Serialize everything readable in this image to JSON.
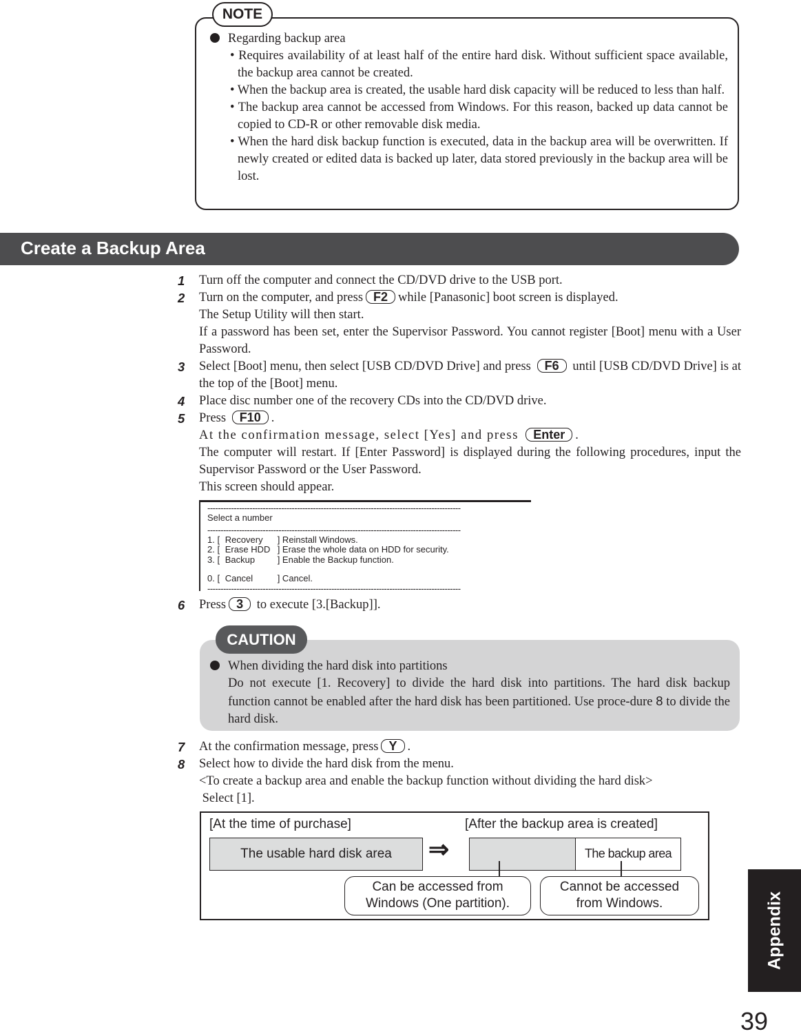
{
  "note": {
    "label": "NOTE",
    "heading": "Regarding backup area",
    "items": [
      "• Requires availability of at least half of the entire hard disk.  Without sufficient space available, the backup area cannot be created.",
      "• When the backup area is created, the usable hard disk capacity will be reduced to less than half.",
      "• The backup area cannot be accessed from Windows.  For this reason, backed up data cannot be copied to CD-R or other removable disk media.",
      "• When the hard disk backup function is executed, data in the backup area will be overwritten.  If newly created or edited data is backed up later, data stored previously in the backup area will be lost."
    ]
  },
  "section_title": "Create a Backup Area",
  "steps": {
    "s1": {
      "num": "1",
      "text": "Turn off the computer and connect the CD/DVD drive to the USB port."
    },
    "s2": {
      "num": "2",
      "a": "Turn on the computer, and press",
      "key": "F2",
      "b": "while [Panasonic] boot screen is displayed.",
      "c": "The Setup Utility will then start.",
      "d": "If a password has been set, enter the Supervisor Password. You cannot register [Boot] menu with a User Password."
    },
    "s3": {
      "num": "3",
      "a": "Select [Boot] menu, then select [USB CD/DVD Drive] and press",
      "key": "F6",
      "b": "until [USB CD/DVD Drive] is at the top of the [Boot] menu."
    },
    "s4": {
      "num": "4",
      "text": "Place disc number one of the recovery CDs into the CD/DVD drive."
    },
    "s5": {
      "num": "5",
      "a": "Press",
      "key": "F10",
      "b": ".",
      "c": "At the confirmation message, select [Yes] and press",
      "key2": "Enter",
      "d": ".",
      "e": "The computer will restart. If [Enter Password] is displayed during the following procedures, input the Supervisor Password or the User Password.",
      "f": "This screen should appear."
    },
    "s6": {
      "num": "6",
      "a": "Press",
      "key": "3",
      "b": "to execute [3.[Backup]]."
    },
    "s7": {
      "num": "7",
      "a": "At the confirmation message, press",
      "key": "Y",
      "b": "."
    },
    "s8": {
      "num": "8",
      "a": "Select how to divide the hard disk from the menu.",
      "b": "<To create a backup area and enable the backup function without dividing the hard disk>",
      "c": " Select [1]."
    }
  },
  "screen": {
    "title": "Select a number",
    "options": [
      {
        "n": "1. [",
        "name": "Recovery",
        "desc": "]  Reinstall Windows."
      },
      {
        "n": "2. [",
        "name": "Erase HDD",
        "desc": "]  Erase the whole data on HDD for security."
      },
      {
        "n": "3. [",
        "name": "Backup",
        "desc": "]  Enable the Backup function."
      },
      {
        "n": "0. [",
        "name": "Cancel",
        "desc": "]  Cancel."
      }
    ]
  },
  "caution": {
    "label": "CAUTION",
    "heading": "When dividing the hard disk into partitions",
    "text_a": "Do not execute [1. Recovery] to divide the hard disk into partitions.  The hard disk backup function cannot be enabled after the hard disk has been partitioned.  Use proce-dure",
    "ref": "8",
    "text_b": "to divide the hard disk."
  },
  "diagram": {
    "before_label": "[At the time of purchase]",
    "after_label": "[After the backup area is created]",
    "usable": "The usable hard disk area",
    "arrow": "⇒",
    "backup": "The backup area",
    "callout1": "Can be accessed from Windows (One partition).",
    "callout2": "Cannot be accessed from Windows."
  },
  "side_tab": "Appendix",
  "page_number": "39"
}
